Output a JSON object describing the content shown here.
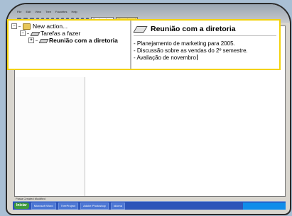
{
  "app": {
    "menu": [
      "File",
      "Edit",
      "View",
      "Tree",
      "Favorites",
      "Help"
    ],
    "toolbar_field_1": "Tarefas a fazer",
    "toolbar_field_2": "Upgrade now!"
  },
  "tree": {
    "root_label": "New action...",
    "child_label": "Tarefas a fazer",
    "grandchild_label": "Reunião com a diretoria",
    "expanders": [
      "−",
      "−",
      "+"
    ]
  },
  "detail": {
    "title": "Reunião com a diretoria",
    "lines": [
      "- Planejamento de marketing para 2005.",
      "- Discussão sobre as vendas do 2º semestre.",
      "- Avaliação de novembro"
    ]
  },
  "statusbar": {
    "text": "Pasta Created   Modified"
  },
  "taskbar": {
    "start_label": "Iniciar",
    "items": [
      "Microsoft Word",
      "TreeProject",
      "Adobe Photoshop"
    ],
    "tray_label": "Idioma"
  },
  "colors": {
    "highlight": "#f3d20c",
    "taskbar": "#2d55b9",
    "background": "#a9bfd4"
  }
}
